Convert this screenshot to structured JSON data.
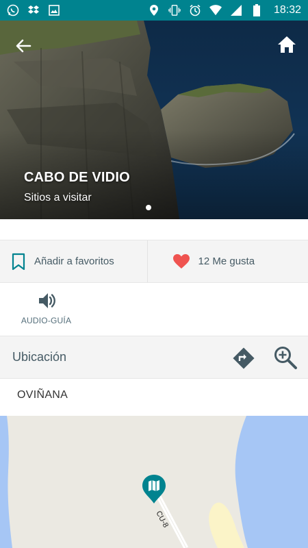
{
  "status_bar": {
    "time": "18:32",
    "left_icons": [
      "whatsapp-icon",
      "dropbox-icon",
      "image-icon"
    ],
    "right_icons": [
      "location-icon",
      "vibrate-icon",
      "alarm-icon",
      "wifi-icon",
      "signal-icon",
      "battery-icon"
    ],
    "color": "#00838f"
  },
  "hero": {
    "title": "CABO DE VIDIO",
    "subtitle": "Sitios a visitar"
  },
  "actions": {
    "favorites_label": "Añadir a favoritos",
    "likes_label": "12 Me gusta",
    "heart_color": "#ef5350"
  },
  "audio_guide": {
    "label": "AUDIO-GUÍA"
  },
  "location": {
    "title": "Ubicación",
    "place": "OVIÑANA",
    "accent_color": "#455a64"
  },
  "map": {
    "road_label": "CU-8",
    "marker_color": "#00838f"
  }
}
